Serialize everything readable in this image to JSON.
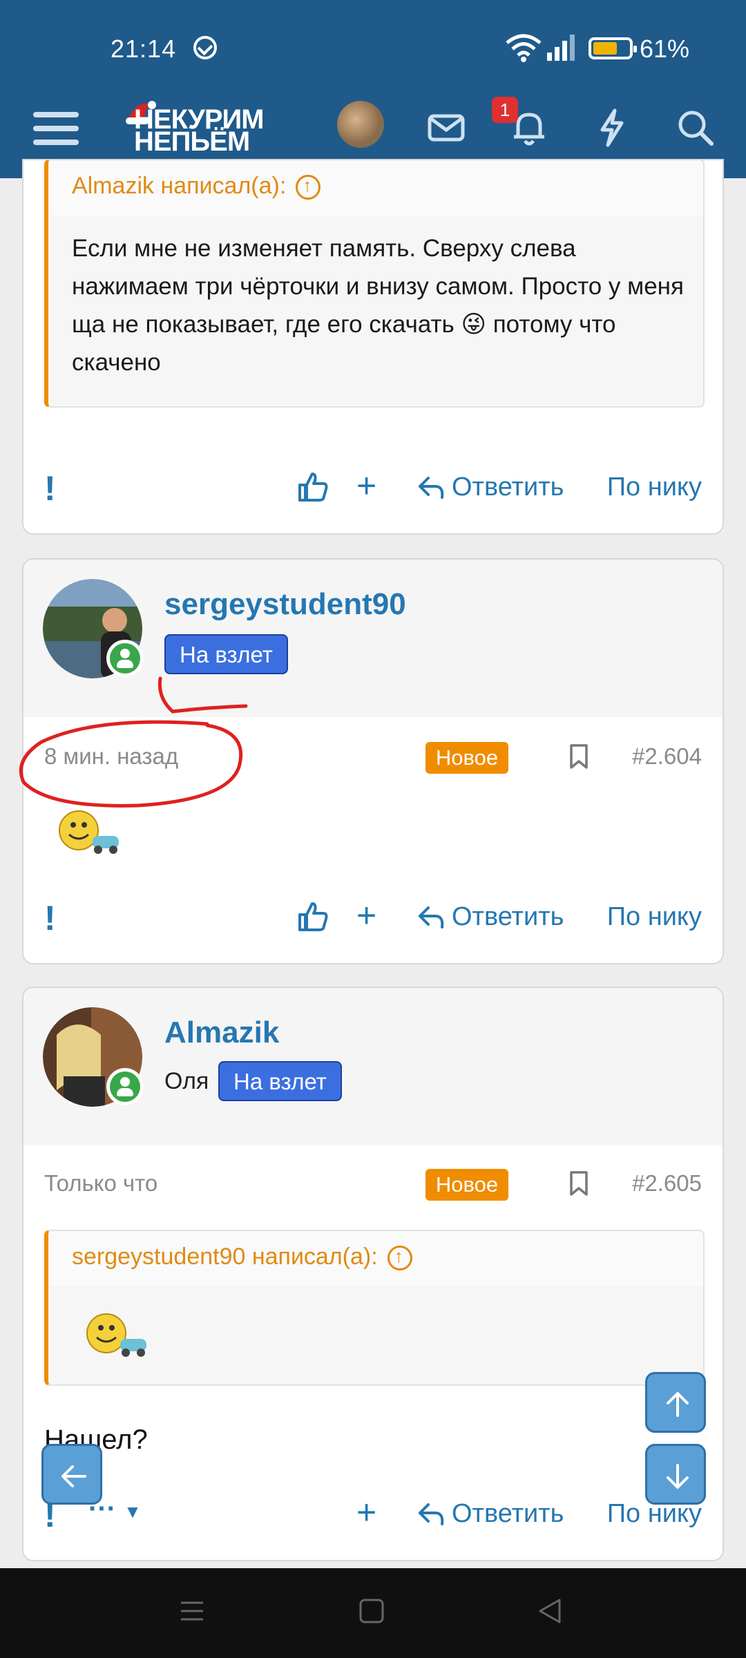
{
  "status_bar": {
    "time": "21:14",
    "battery": "61%",
    "battery_level": 0.61
  },
  "header": {
    "logo_line1": "НЕКУРИМ",
    "logo_line2": "НЕПЬЁМ",
    "notifications_count": "1",
    "icons": [
      "menu-icon",
      "avatar",
      "mail-icon",
      "bell-icon",
      "lightning-icon",
      "search-icon"
    ]
  },
  "post_top": {
    "quote_author": "Almazik написал(а):",
    "quote_text": "Если мне не изменяет память. Сверху слева нажимаем три чёрточки и внизу самом. Просто у меня ща не показывает, где его скачать 😜 потому что скачено",
    "actions": {
      "reply": "Ответить",
      "by_nick": "По нику"
    }
  },
  "post_2604": {
    "username": "sergeystudent90",
    "rank": "На взлет",
    "time": "8 мин. назад",
    "new_badge": "Новое",
    "number": "#2.604",
    "actions": {
      "reply": "Ответить",
      "by_nick": "По нику"
    }
  },
  "post_2605": {
    "username": "Almazik",
    "user_title": "Оля",
    "rank": "На взлет",
    "time": "Только что",
    "new_badge": "Новое",
    "number": "#2.605",
    "quote_author": "sergeystudent90 написал(а):",
    "message": "Нашел?",
    "actions": {
      "more": "···",
      "reply": "Ответить",
      "by_nick": "По нику"
    }
  },
  "colors": {
    "header": "#1f5a8b",
    "link": "#2577b1",
    "new_badge": "#f08c00",
    "rank": "#3b6fe0",
    "quote_accent": "#f08c00"
  }
}
